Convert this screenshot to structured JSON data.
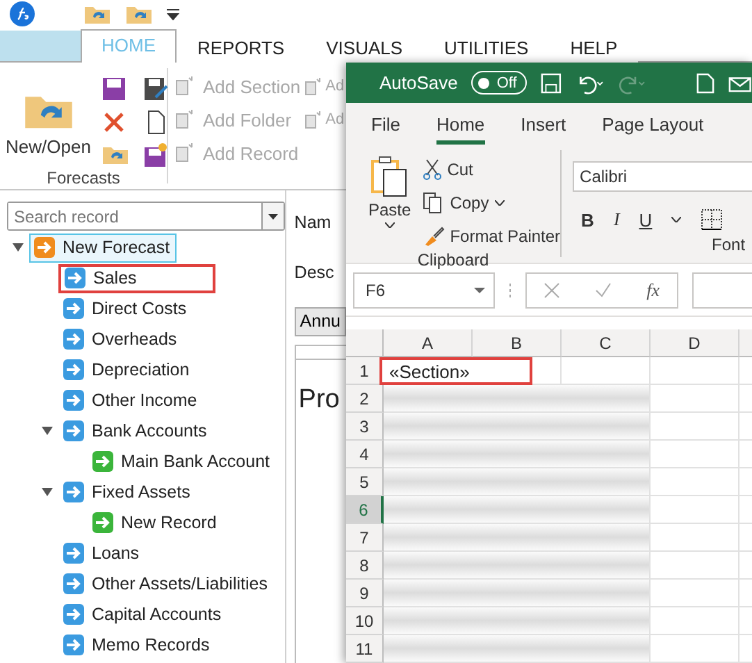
{
  "app": {
    "tabs": [
      {
        "label": "HOME",
        "selected": true
      },
      {
        "label": "REPORTS",
        "selected": false
      },
      {
        "label": "VISUALS",
        "selected": false
      },
      {
        "label": "UTILITIES",
        "selected": false
      },
      {
        "label": "HELP",
        "selected": false
      }
    ],
    "ribbon": {
      "big_button": "New/Open",
      "group_label": "Forecasts",
      "actions": [
        {
          "label": "Add Section",
          "disabled": true
        },
        {
          "label": "Add Folder",
          "disabled": true
        },
        {
          "label": "Add Record",
          "disabled": true
        }
      ],
      "actions_cut": [
        "Ad",
        "Ad"
      ]
    },
    "search": {
      "placeholder": "Search record"
    },
    "tree": [
      {
        "label": "New Forecast",
        "kind": "forecast",
        "selected": true,
        "highlighted": false,
        "expanded": true,
        "children": [
          {
            "label": "Sales",
            "kind": "section",
            "selected": false,
            "highlighted": true
          },
          {
            "label": "Direct Costs",
            "kind": "section",
            "selected": false,
            "highlighted": false
          },
          {
            "label": "Overheads",
            "kind": "section",
            "selected": false,
            "highlighted": false
          },
          {
            "label": "Depreciation",
            "kind": "section",
            "selected": false,
            "highlighted": false
          },
          {
            "label": "Other Income",
            "kind": "section",
            "selected": false,
            "highlighted": false
          },
          {
            "label": "Bank Accounts",
            "kind": "section",
            "selected": false,
            "highlighted": false,
            "expanded": true,
            "children": [
              {
                "label": "Main Bank Account",
                "kind": "record",
                "selected": false,
                "highlighted": false
              }
            ]
          },
          {
            "label": "Fixed Assets",
            "kind": "section",
            "selected": false,
            "highlighted": false,
            "expanded": true,
            "children": [
              {
                "label": "New Record",
                "kind": "record",
                "selected": false,
                "highlighted": false
              }
            ]
          },
          {
            "label": "Loans",
            "kind": "section",
            "selected": false,
            "highlighted": false
          },
          {
            "label": "Other Assets/Liabilities",
            "kind": "section",
            "selected": false,
            "highlighted": false
          },
          {
            "label": "Capital Accounts",
            "kind": "section",
            "selected": false,
            "highlighted": false
          },
          {
            "label": "Memo Records",
            "kind": "section",
            "selected": false,
            "highlighted": false
          }
        ]
      }
    ],
    "form": {
      "name_label": "Nam",
      "description_label": "Desc",
      "tab": "Annu",
      "heading": "Pro"
    }
  },
  "excel": {
    "autosave": {
      "label": "AutoSave",
      "on": false,
      "state_text": "Off"
    },
    "tabs": [
      {
        "label": "File",
        "selected": false
      },
      {
        "label": "Home",
        "selected": true
      },
      {
        "label": "Insert",
        "selected": false
      },
      {
        "label": "Page Layout",
        "selected": false
      }
    ],
    "clipboard": {
      "paste": "Paste",
      "cut": "Cut",
      "copy": "Copy",
      "format_painter": "Format Painter",
      "label": "Clipboard"
    },
    "font": {
      "name": "Calibri",
      "bold": "B",
      "italic": "I",
      "underline": "U",
      "label": "Font"
    },
    "name_box": "F6",
    "formula_symbol": "fx",
    "columns": [
      "A",
      "B",
      "C",
      "D"
    ],
    "rows": [
      {
        "number": "1",
        "cell_a": "«Section»",
        "highlighted": true,
        "selected": false,
        "blurred": false
      },
      {
        "number": "2",
        "highlighted": false,
        "selected": false,
        "blurred": true
      },
      {
        "number": "3",
        "highlighted": false,
        "selected": false,
        "blurred": true
      },
      {
        "number": "4",
        "highlighted": false,
        "selected": false,
        "blurred": true
      },
      {
        "number": "5",
        "highlighted": false,
        "selected": false,
        "blurred": true
      },
      {
        "number": "6",
        "highlighted": false,
        "selected": true,
        "blurred": true
      },
      {
        "number": "7",
        "highlighted": false,
        "selected": false,
        "blurred": true
      },
      {
        "number": "8",
        "highlighted": false,
        "selected": false,
        "blurred": true
      },
      {
        "number": "9",
        "highlighted": false,
        "selected": false,
        "blurred": true
      },
      {
        "number": "10",
        "highlighted": false,
        "selected": false,
        "blurred": true
      },
      {
        "number": "11",
        "highlighted": false,
        "selected": false,
        "blurred": true
      }
    ]
  }
}
